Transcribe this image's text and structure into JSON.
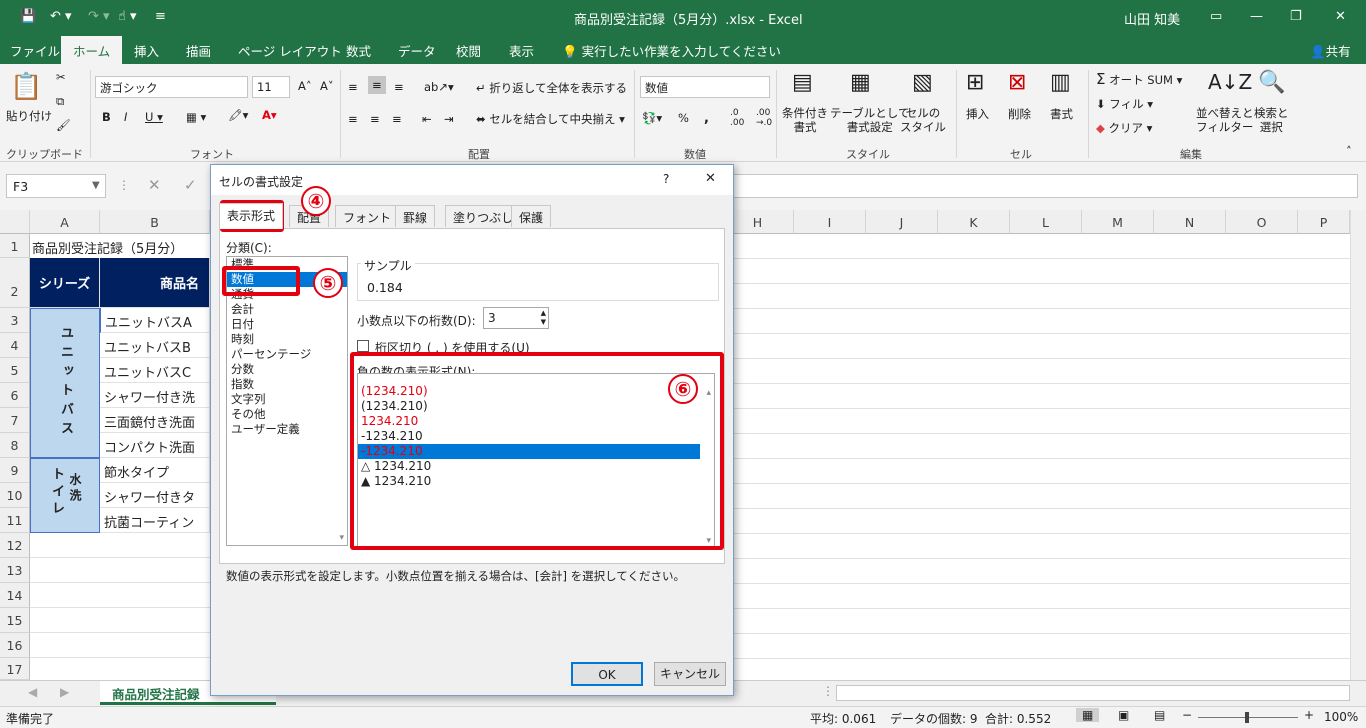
{
  "titlebar": {
    "title": "商品別受注記録（5月分）.xlsx - Excel",
    "user": "山田 知美"
  },
  "tabs": [
    "ファイル",
    "ホーム",
    "挿入",
    "描画",
    "ページ レイアウト",
    "数式",
    "データ",
    "校閲",
    "表示"
  ],
  "tell_me": "実行したい作業を入力してください",
  "share": "共有",
  "ribbon": {
    "paste": "貼り付け",
    "clipboard": "クリップボード",
    "font_name": "游ゴシック",
    "font_size": "11",
    "font_group": "フォント",
    "wrap": "折り返して全体を表示する",
    "merge": "セルを結合して中央揃え",
    "align_group": "配置",
    "number_format": "数値",
    "number_group": "数値",
    "cond_format": "条件付き\n書式",
    "table_format": "テーブルとして\n書式設定",
    "cell_style": "セルの\nスタイル",
    "style_group": "スタイル",
    "insert": "挿入",
    "delete": "削除",
    "format": "書式",
    "cells_group": "セル",
    "autosum": "オート SUM",
    "fill": "フィル",
    "clear": "クリア",
    "sort": "並べ替えと\nフィルター",
    "find": "検索と\n選択",
    "edit_group": "編集"
  },
  "namebox": "F3",
  "columns": [
    "A",
    "B",
    "H",
    "I",
    "J",
    "K",
    "L",
    "M",
    "N",
    "O",
    "P"
  ],
  "rows": [
    "1",
    "2",
    "3",
    "4",
    "5",
    "6",
    "7",
    "8",
    "9",
    "10",
    "11",
    "12",
    "13",
    "14",
    "15",
    "16",
    "17"
  ],
  "cells": {
    "a1": "商品別受注記録（5月分）",
    "a2": "シリーズ",
    "b2": "商品名",
    "series1": "ユニットバス",
    "series2_a": "トイレ",
    "series2_b": "水洗",
    "b3": "ユニットバスA",
    "b4": "ユニットバスB",
    "b5": "ユニットバスC",
    "b6": "シャワー付き洗",
    "b7": "三面鏡付き洗面",
    "b8": "コンパクト洗面",
    "b9": "節水タイプ",
    "b10": "シャワー付きタ",
    "b11": "抗菌コーティン"
  },
  "sheet_tab": "商品別受注記録",
  "status": {
    "ready": "準備完了",
    "avg": "平均: 0.061",
    "count": "データの個数: 9",
    "sum": "合計: 0.552",
    "zoom": "100%"
  },
  "dialog": {
    "title": "セルの書式設定",
    "help": "?",
    "close": "✕",
    "tabs": [
      "表示形式",
      "配置",
      "フォント",
      "罫線",
      "塗りつぶし",
      "保護"
    ],
    "category_label": "分類(C):",
    "categories": [
      "標準",
      "数値",
      "通貨",
      "会計",
      "日付",
      "時刻",
      "パーセンテージ",
      "分数",
      "指数",
      "文字列",
      "その他",
      "ユーザー定義"
    ],
    "sample_label": "サンプル",
    "sample_value": "0.184",
    "decimals_label": "小数点以下の桁数(D):",
    "decimals_value": "3",
    "separator_label": "桁区切り ( , ) を使用する(U)",
    "negative_label": "負の数の表示形式(N):",
    "negatives": [
      "(1234.210)",
      "(1234.210)",
      "1234.210",
      "-1234.210",
      "-1234.210",
      "△ 1234.210",
      "▲ 1234.210"
    ],
    "description": "数値の表示形式を設定します。小数点位置を揃える場合は、[会計] を選択してください。",
    "ok": "OK",
    "cancel": "キャンセル"
  },
  "badges": [
    "④",
    "⑤",
    "⑥"
  ],
  "colors": {
    "excel_green": "#217346",
    "highlight": "#e3000f",
    "selection": "#0078d7",
    "header_navy": "#002060",
    "series_blue": "#bdd7ee"
  }
}
